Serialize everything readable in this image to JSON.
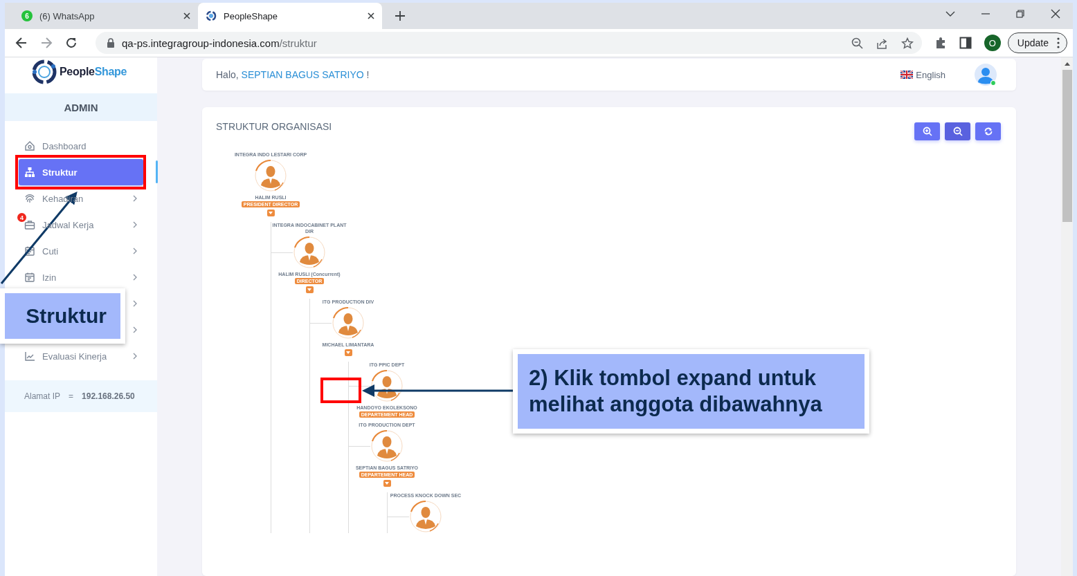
{
  "browser": {
    "tabs": [
      {
        "title": "(6) WhatsApp",
        "badge": "6",
        "kind": "chat",
        "selected": false
      },
      {
        "title": "PeopleShape",
        "kind": "app",
        "selected": true
      }
    ],
    "url_host": "qa-ps.integragroup-indonesia.com",
    "url_path": "/struktur",
    "profile_initial": "O",
    "update_label": "Update"
  },
  "logo": {
    "name_dark": "People",
    "name_accent": "Shape"
  },
  "sidebar": {
    "role": "ADMIN",
    "items": [
      {
        "label": "Dashboard",
        "submenu": false,
        "selected": false
      },
      {
        "label": "Struktur",
        "submenu": false,
        "selected": true
      },
      {
        "label": "Kehadiran",
        "submenu": true,
        "selected": false
      },
      {
        "label": "Jadwal Kerja",
        "submenu": true,
        "badge": "4",
        "selected": false
      },
      {
        "label": "Cuti",
        "submenu": true,
        "selected": false
      },
      {
        "label": "Izin",
        "submenu": true,
        "selected": false
      },
      {
        "submenu": true
      },
      {
        "submenu": true
      },
      {
        "label": "Evaluasi Kinerja",
        "submenu": true,
        "selected": false
      }
    ],
    "ip_label": "Alamat IP",
    "ip_sep": "=",
    "ip_value": "192.168.26.50"
  },
  "header": {
    "greeting": "Halo,",
    "user": "SEPTIAN BAGUS SATRIYO",
    "suffix": "!",
    "language": "English"
  },
  "org": {
    "title": "STRUKTUR ORGANISASI",
    "tree": [
      {
        "unit": "INTEGRA INDO LESTARI CORP",
        "name": "HALIM RUSLI",
        "role": "PRESIDENT DIRECTOR",
        "expandable": true,
        "children": [
          {
            "unit": "INTEGRA INDOCABINET PLANT DIR",
            "name": "HALIM RUSLI (Concurrent)",
            "role": "DIRECTOR",
            "expandable": true,
            "children": [
              {
                "unit": "ITG PRODUCTION DIV",
                "name": "MICHAEL LIMANTARA",
                "expandable": true,
                "children": [
                  {
                    "unit": "ITG PPIC DEPT",
                    "name": "HANDOYO EKOLEKSONO",
                    "role": "DEPARTEMENT HEAD",
                    "expandable": false
                  },
                  {
                    "unit": "ITG PRODUCTION DEPT",
                    "name": "SEPTIAN BAGUS SATRIYO",
                    "role": "DEPARTEMENT HEAD",
                    "expandable": true,
                    "children": [
                      {
                        "unit": "PROCESS KNOCK DOWN SEC",
                        "expandable": false
                      }
                    ]
                  }
                ]
              }
            ]
          }
        ]
      }
    ]
  },
  "annotations": [
    {
      "kind": "note",
      "text": "Struktur"
    },
    {
      "kind": "note",
      "text": "2) Klik tombol expand untuk melihat anggota dibawahnya"
    }
  ]
}
